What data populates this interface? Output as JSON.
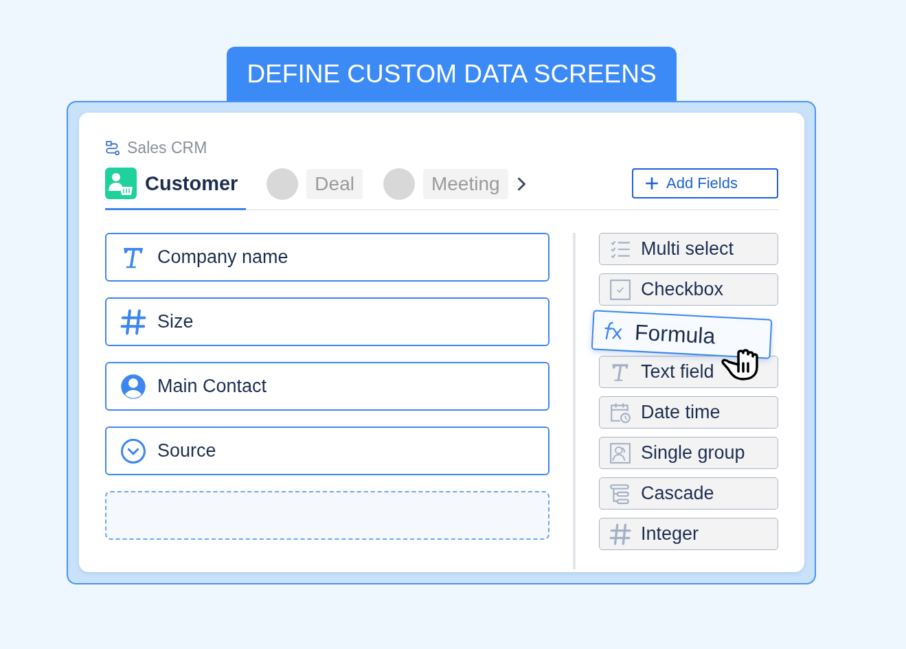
{
  "banner": {
    "title": "DEFINE CUSTOM DATA SCREENS"
  },
  "breadcrumb": {
    "label": "Sales CRM"
  },
  "tabs": [
    {
      "label": "Customer",
      "selected": true
    },
    {
      "label": "Deal",
      "selected": false
    },
    {
      "label": "Meeting",
      "selected": false
    }
  ],
  "add_button": {
    "label": "Add Fields"
  },
  "fields": [
    {
      "label": "Company name",
      "kind": "text"
    },
    {
      "label": "Size",
      "kind": "number"
    },
    {
      "label": "Main Contact",
      "kind": "contact"
    },
    {
      "label": "Source",
      "kind": "dropdown"
    }
  ],
  "drop_zone": true,
  "palette": [
    {
      "label": "Multi select",
      "kind": "multiselect",
      "dragging": false
    },
    {
      "label": "Checkbox",
      "kind": "checkbox",
      "dragging": false
    },
    {
      "label": "Formula",
      "kind": "formula",
      "dragging": true
    },
    {
      "label": "Text field",
      "kind": "text",
      "dragging": false
    },
    {
      "label": "Date time",
      "kind": "datetime",
      "dragging": false
    },
    {
      "label": "Single group",
      "kind": "group",
      "dragging": false
    },
    {
      "label": "Cascade",
      "kind": "cascade",
      "dragging": false
    },
    {
      "label": "Integer",
      "kind": "number",
      "dragging": false
    }
  ]
}
